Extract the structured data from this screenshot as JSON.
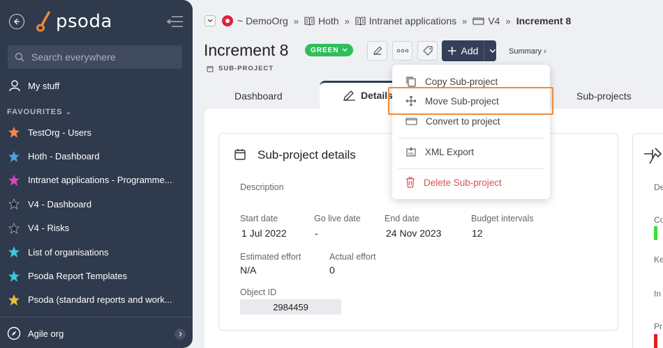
{
  "sidebar": {
    "logo": "psoda",
    "search_placeholder": "Search everywhere",
    "my_stuff": "My stuff",
    "favourites_header": "FAVOURITES",
    "favourites": [
      {
        "label": "TestOrg - Users",
        "color": "#f5894a"
      },
      {
        "label": "Hoth - Dashboard",
        "color": "#4aa3e8"
      },
      {
        "label": "Intranet applications - Programme...",
        "color": "#e040c8"
      },
      {
        "label": "V4 - Dashboard",
        "color": "#1e2430"
      },
      {
        "label": "V4 - Risks",
        "color": "#1e2430"
      },
      {
        "label": "List of organisations",
        "color": "#3ec6e0"
      },
      {
        "label": "Psoda Report Templates",
        "color": "#3ec6e0"
      },
      {
        "label": "Psoda (standard reports and work...",
        "color": "#e8c040"
      }
    ],
    "bottom_item": "Agile org"
  },
  "breadcrumb": {
    "org": "~ DemoOrg",
    "items": [
      "Hoth",
      "Intranet applications",
      "V4"
    ],
    "current": "Increment 8"
  },
  "header": {
    "title": "Increment 8",
    "status": "GREEN",
    "type": "SUB-PROJECT",
    "add_label": "Add",
    "summary_link": "Summary ›"
  },
  "tabs": [
    "Dashboard",
    "Details",
    "Sub-projects"
  ],
  "details": {
    "title": "Sub-project details",
    "description_label": "Description",
    "start_date_label": "Start date",
    "start_date": "1 Jul 2022",
    "go_live_label": "Go live date",
    "go_live": "-",
    "end_date_label": "End date",
    "end_date": "24 Nov 2023",
    "budget_label": "Budget intervals",
    "budget": "12",
    "est_effort_label": "Estimated effort",
    "est_effort": "N/A",
    "actual_effort_label": "Actual effort",
    "actual_effort": "0",
    "object_id_label": "Object ID",
    "object_id": "2984459"
  },
  "right_card": {
    "labels": [
      "De",
      "Co",
      "Ke",
      "In",
      "Pr"
    ]
  },
  "dropdown": {
    "items": [
      {
        "label": "Copy Sub-project"
      },
      {
        "label": "Move Sub-project"
      },
      {
        "label": "Convert to project"
      },
      {
        "label": "XML Export"
      },
      {
        "label": "Delete Sub-project"
      }
    ]
  },
  "colors": {
    "sidebar_bg": "#2f3a4d",
    "status_green": "#2fbf5a",
    "highlight": "#f08a36",
    "danger": "#d9534f"
  }
}
